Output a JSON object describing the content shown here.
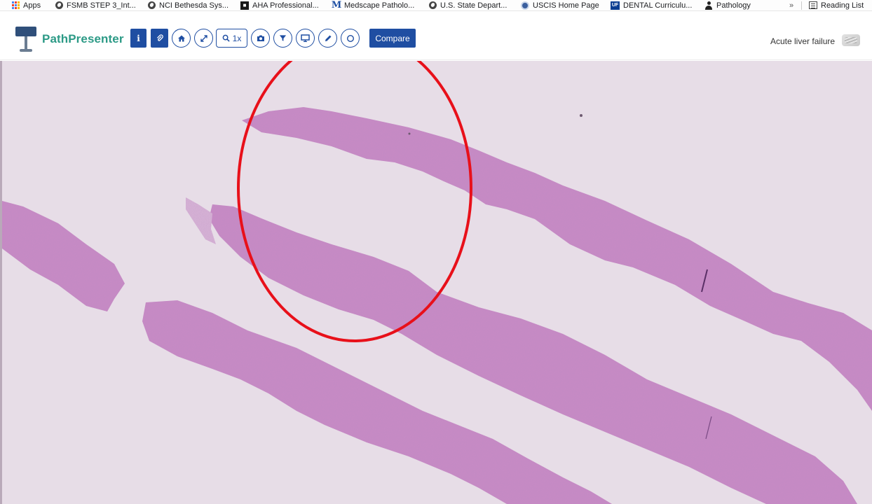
{
  "bookmarks": {
    "items": [
      {
        "label": "Apps",
        "icon": "apps-grid-icon"
      },
      {
        "label": "FSMB STEP 3_Int...",
        "icon": "globe-icon"
      },
      {
        "label": "NCI Bethesda Sys...",
        "icon": "globe-icon"
      },
      {
        "label": "AHA Professional...",
        "icon": "aha-icon"
      },
      {
        "label": "Medscape Patholo...",
        "icon": "medscape-icon"
      },
      {
        "label": "U.S. State Depart...",
        "icon": "globe-icon"
      },
      {
        "label": "USCIS Home Page",
        "icon": "uscis-seal-icon"
      },
      {
        "label": "DENTAL Curriculu...",
        "icon": "uf-icon"
      },
      {
        "label": "Pathology",
        "icon": "person-icon"
      }
    ],
    "overflow": "»",
    "reading_list": "Reading List",
    "uf_badge": "UF",
    "medscape_glyph": "M"
  },
  "toolbar": {
    "brand": "PathPresenter",
    "info_glyph": "i",
    "zoom_label": "1x",
    "compare_label": "Compare",
    "case_title": "Acute liver failure",
    "accent_color": "#1f4ea2",
    "brand_color": "#2c9a86",
    "icons": [
      "info-icon",
      "attachment-icon",
      "home-icon",
      "fullscreen-icon",
      "zoom-icon",
      "camera-icon",
      "filter-icon",
      "monitor-icon",
      "pen-icon",
      "circle-annotation-icon"
    ]
  },
  "viewer": {
    "background_color": "#e7dde7",
    "tissue_color": "#c98bc6",
    "annotation_color": "#e8101a",
    "annotation": "red-ellipse-annotation"
  }
}
